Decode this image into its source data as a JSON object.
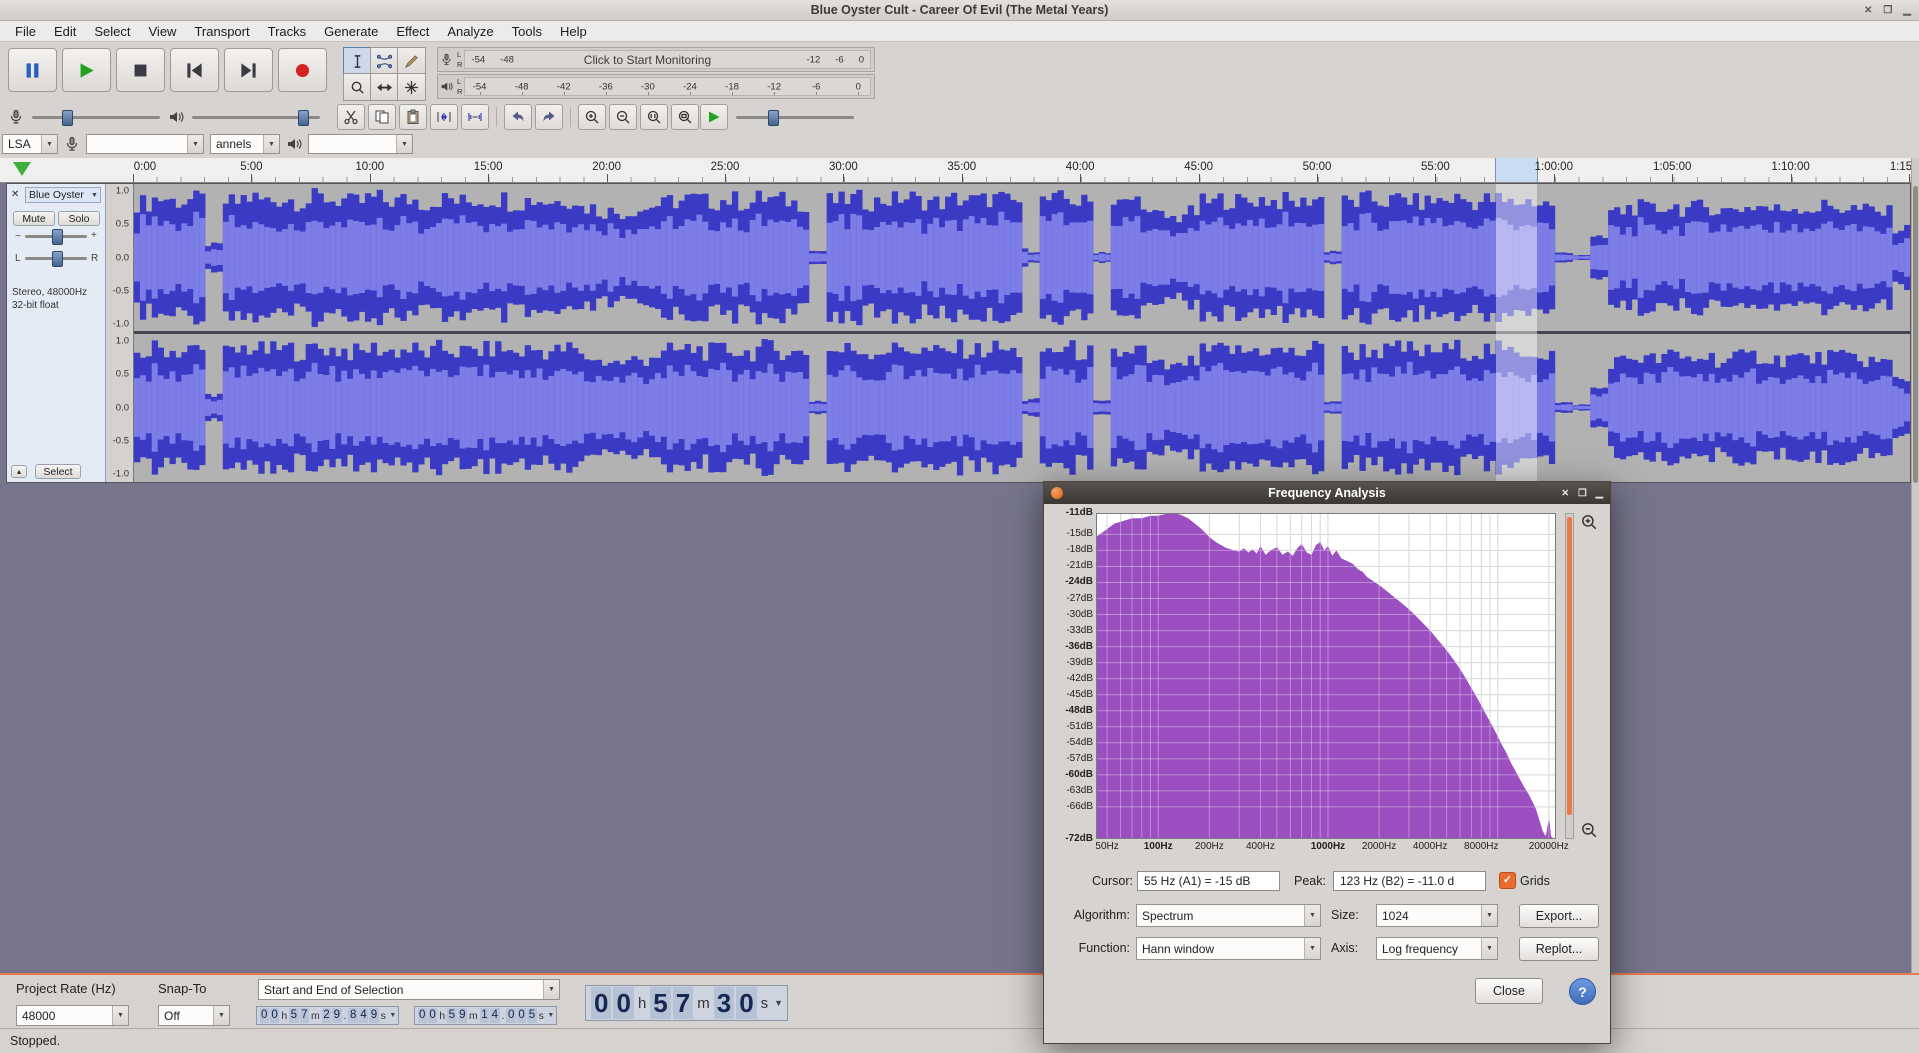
{
  "window": {
    "title": "Blue Oyster Cult - Career Of Evil (The Metal Years)",
    "controls": [
      "✕",
      "❐",
      "▁"
    ]
  },
  "menu": {
    "items": [
      "File",
      "Edit",
      "Select",
      "View",
      "Transport",
      "Tracks",
      "Generate",
      "Effect",
      "Analyze",
      "Tools",
      "Help"
    ]
  },
  "transport": {
    "buttons": [
      {
        "icon": "pause-icon"
      },
      {
        "icon": "play-icon"
      },
      {
        "icon": "stop-icon"
      },
      {
        "icon": "skip-start-icon"
      },
      {
        "icon": "skip-end-icon"
      },
      {
        "icon": "record-icon"
      }
    ]
  },
  "tools": {
    "buttons": [
      {
        "icon": "selection-tool-icon",
        "pressed": true
      },
      {
        "icon": "envelope-tool-icon",
        "pressed": false
      },
      {
        "icon": "draw-tool-icon",
        "pressed": false
      },
      {
        "icon": "zoom-tool-icon",
        "pressed": false
      },
      {
        "icon": "timeshift-tool-icon",
        "pressed": false
      },
      {
        "icon": "multi-tool-icon",
        "pressed": false
      }
    ]
  },
  "meters": {
    "record": {
      "monitor_text": "Click to Start Monitoring",
      "left_scale": [
        "-54",
        "-48"
      ],
      "right_scale": [
        "-12",
        "-6",
        "0"
      ],
      "channels": [
        "L",
        "R"
      ]
    },
    "play": {
      "scale": [
        "-54",
        "-48",
        "-42",
        "-36",
        "-30",
        "-24",
        "-18",
        "-12",
        "-6",
        "0"
      ],
      "channels": [
        "L",
        "R"
      ]
    }
  },
  "mixer": {
    "record_volume": 0.25,
    "play_volume": 0.9
  },
  "edit_toolbar": {
    "buttons": [
      "cut-icon",
      "copy-icon",
      "paste-icon",
      "trim-icon",
      "silence-icon",
      "|",
      "undo-icon",
      "redo-icon",
      "|",
      "zoom-in-icon",
      "zoom-out-icon",
      "zoom-sel-icon",
      "zoom-fit-icon"
    ]
  },
  "play_at_speed": {
    "icon": "play-speed-icon",
    "speed": 0.3
  },
  "device": {
    "host": "LSA",
    "record_device": "",
    "channels": "annels",
    "play_device": ""
  },
  "timeline": {
    "labels": [
      "0:00",
      "5:00",
      "10:00",
      "15:00",
      "20:00",
      "25:00",
      "30:00",
      "35:00",
      "40:00",
      "45:00",
      "50:00",
      "55:00",
      "1:00:00",
      "1:05:00",
      "1:10:00",
      "1:15:00"
    ],
    "total_minutes": 75,
    "selection_start_min": 57.497,
    "selection_end_min": 59.233
  },
  "track": {
    "name": "Blue Oyster",
    "mute_label": "Mute",
    "solo_label": "Solo",
    "gain_min": "−",
    "gain_max": "+",
    "pan_left": "L",
    "pan_right": "R",
    "info_line1": "Stereo, 48000Hz",
    "info_line2": "32-bit float",
    "select_label": "Select",
    "ruler_labels": [
      "1.0",
      "0.5",
      "0.0",
      "-0.5",
      "-1.0"
    ],
    "envelope": [
      0.85,
      0.92,
      0.88,
      0.9,
      0.2,
      0.86,
      0.93,
      0.89,
      0.91,
      0.87,
      0.93,
      0.9,
      0.86,
      0.92,
      0.88,
      0.9,
      0.85,
      0.91,
      0.87,
      0.89,
      0.92,
      0.86,
      0.9,
      0.88,
      0.91,
      0.78,
      0.72,
      0.7,
      0.75,
      0.82,
      0.88,
      0.91,
      0.87,
      0.9,
      0.86,
      0.92,
      0.89,
      0.85,
      0.12,
      0.88,
      0.91,
      0.87,
      0.9,
      0.93,
      0.88,
      0.86,
      0.91,
      0.89,
      0.92,
      0.87,
      0.13,
      0.89,
      0.91,
      0.86,
      0.1,
      0.84,
      0.9,
      0.66,
      0.62,
      0.7,
      0.86,
      0.9,
      0.87,
      0.91,
      0.88,
      0.85,
      0.92,
      0.12,
      0.86,
      0.9,
      0.88,
      0.91,
      0.86,
      0.89,
      0.92,
      0.87,
      0.9,
      0.85,
      0.88,
      0.84,
      0.08,
      0.05,
      0.3,
      0.72,
      0.78,
      0.75,
      0.8,
      0.76,
      0.79,
      0.74,
      0.78,
      0.8,
      0.75,
      0.79,
      0.76,
      0.8,
      0.77,
      0.74,
      0.7,
      0.45
    ]
  },
  "selection_bar": {
    "rate_label": "Project Rate (Hz)",
    "rate_value": "48000",
    "snap_label": "Snap-To",
    "snap_value": "Off",
    "mode_value": "Start and End of Selection",
    "sel_start": "00h57m29.849s",
    "sel_end": "00h59m14.005s",
    "audio_position": "00h57m30s"
  },
  "status": {
    "text": "Stopped."
  },
  "freq_dialog": {
    "title": "Frequency Analysis",
    "controls": [
      "✕",
      "❒",
      "▁"
    ],
    "cursor_label": "Cursor:",
    "cursor_value": "55 Hz (A1) = -15 dB",
    "peak_label": "Peak:",
    "peak_value": "123 Hz (B2) = -11.0 d",
    "grids_label": "Grids",
    "grids_checked": true,
    "algorithm_label": "Algorithm:",
    "algorithm_value": "Spectrum",
    "size_label": "Size:",
    "size_value": "1024",
    "function_label": "Function:",
    "function_value": "Hann window",
    "axis_label": "Axis:",
    "axis_value": "Log frequency",
    "export_label": "Export...",
    "replot_label": "Replot...",
    "close_label": "Close",
    "help_label": "?"
  },
  "chart_data": {
    "type": "area",
    "title": "Frequency Analysis spectrum",
    "xscale": "log",
    "xlim": [
      43,
      22050
    ],
    "ylim": [
      -72,
      -11
    ],
    "grid": true,
    "fill_color": "#9b4fc1",
    "x_ticks": [
      {
        "f": 50,
        "label": "50Hz",
        "bold": false
      },
      {
        "f": 100,
        "label": "100Hz",
        "bold": true
      },
      {
        "f": 200,
        "label": "200Hz",
        "bold": false
      },
      {
        "f": 400,
        "label": "400Hz",
        "bold": false
      },
      {
        "f": 1000,
        "label": "1000Hz",
        "bold": true
      },
      {
        "f": 2000,
        "label": "2000Hz",
        "bold": false
      },
      {
        "f": 4000,
        "label": "4000Hz",
        "bold": false
      },
      {
        "f": 8000,
        "label": "8000Hz",
        "bold": false
      },
      {
        "f": 20000,
        "label": "20000Hz",
        "bold": false
      }
    ],
    "y_ticks": [
      {
        "db": -11,
        "label": "-11dB",
        "bold": true
      },
      {
        "db": -15,
        "label": "-15dB",
        "bold": false
      },
      {
        "db": -18,
        "label": "-18dB",
        "bold": false
      },
      {
        "db": -21,
        "label": "-21dB",
        "bold": false
      },
      {
        "db": -24,
        "label": "-24dB",
        "bold": true
      },
      {
        "db": -27,
        "label": "-27dB",
        "bold": false
      },
      {
        "db": -30,
        "label": "-30dB",
        "bold": false
      },
      {
        "db": -33,
        "label": "-33dB",
        "bold": false
      },
      {
        "db": -36,
        "label": "-36dB",
        "bold": true
      },
      {
        "db": -39,
        "label": "-39dB",
        "bold": false
      },
      {
        "db": -42,
        "label": "-42dB",
        "bold": false
      },
      {
        "db": -45,
        "label": "-45dB",
        "bold": false
      },
      {
        "db": -48,
        "label": "-48dB",
        "bold": true
      },
      {
        "db": -51,
        "label": "-51dB",
        "bold": false
      },
      {
        "db": -54,
        "label": "-54dB",
        "bold": false
      },
      {
        "db": -57,
        "label": "-57dB",
        "bold": false
      },
      {
        "db": -60,
        "label": "-60dB",
        "bold": true
      },
      {
        "db": -63,
        "label": "-63dB",
        "bold": false
      },
      {
        "db": -66,
        "label": "-66dB",
        "bold": false
      },
      {
        "db": -72,
        "label": "-72dB",
        "bold": true
      }
    ],
    "series": [
      {
        "name": "spectrum",
        "points": [
          [
            43,
            -15.5
          ],
          [
            50,
            -14
          ],
          [
            55,
            -13
          ],
          [
            62,
            -12.5
          ],
          [
            70,
            -12
          ],
          [
            80,
            -12
          ],
          [
            90,
            -11.5
          ],
          [
            100,
            -11.5
          ],
          [
            110,
            -11.2
          ],
          [
            123,
            -11
          ],
          [
            135,
            -11.3
          ],
          [
            150,
            -12
          ],
          [
            165,
            -13
          ],
          [
            180,
            -14
          ],
          [
            200,
            -15.5
          ],
          [
            220,
            -16.5
          ],
          [
            250,
            -17.5
          ],
          [
            280,
            -18
          ],
          [
            300,
            -18.2
          ],
          [
            320,
            -17.6
          ],
          [
            340,
            -18.4
          ],
          [
            360,
            -17.8
          ],
          [
            380,
            -18.6
          ],
          [
            400,
            -17.2
          ],
          [
            430,
            -18.8
          ],
          [
            460,
            -18
          ],
          [
            500,
            -17.4
          ],
          [
            540,
            -18.8
          ],
          [
            580,
            -18.2
          ],
          [
            620,
            -19
          ],
          [
            660,
            -17.6
          ],
          [
            700,
            -16.8
          ],
          [
            750,
            -18.4
          ],
          [
            800,
            -18.8
          ],
          [
            850,
            -17
          ],
          [
            900,
            -16.4
          ],
          [
            950,
            -18
          ],
          [
            1000,
            -17.2
          ],
          [
            1060,
            -19
          ],
          [
            1120,
            -18
          ],
          [
            1200,
            -19.5
          ],
          [
            1300,
            -20
          ],
          [
            1400,
            -20.5
          ],
          [
            1500,
            -21.5
          ],
          [
            1600,
            -22
          ],
          [
            1700,
            -23
          ],
          [
            1800,
            -23.5
          ],
          [
            1900,
            -24
          ],
          [
            2000,
            -24.5
          ],
          [
            2200,
            -25.5
          ],
          [
            2400,
            -26.5
          ],
          [
            2700,
            -27.8
          ],
          [
            3000,
            -29
          ],
          [
            3300,
            -30.3
          ],
          [
            3600,
            -31.5
          ],
          [
            4000,
            -33
          ],
          [
            4400,
            -34.6
          ],
          [
            4800,
            -36
          ],
          [
            5200,
            -37.4
          ],
          [
            5600,
            -38.8
          ],
          [
            6000,
            -40.2
          ],
          [
            6500,
            -42
          ],
          [
            7000,
            -43.8
          ],
          [
            7500,
            -45.4
          ],
          [
            8000,
            -47
          ],
          [
            8500,
            -48.6
          ],
          [
            9000,
            -50
          ],
          [
            9500,
            -51.4
          ],
          [
            10000,
            -52.8
          ],
          [
            10600,
            -54.4
          ],
          [
            11200,
            -55.8
          ],
          [
            12000,
            -57.8
          ],
          [
            12800,
            -59.4
          ],
          [
            13600,
            -61
          ],
          [
            14400,
            -62.4
          ],
          [
            15200,
            -63.6
          ],
          [
            16000,
            -65
          ],
          [
            16800,
            -66.4
          ],
          [
            17600,
            -68.5
          ],
          [
            18400,
            -70.5
          ],
          [
            19200,
            -71.5
          ],
          [
            19800,
            -69
          ],
          [
            20200,
            -68.5
          ],
          [
            20600,
            -71.5
          ],
          [
            21500,
            -72
          ],
          [
            22050,
            -72
          ]
        ]
      }
    ]
  },
  "colors": {
    "accent_orange": "#e87a4e",
    "wave_dark": "#3a3ac4",
    "wave_light": "#7d7de8",
    "canvas": "#76758b",
    "spectrum_fill": "#9b4fc1"
  }
}
